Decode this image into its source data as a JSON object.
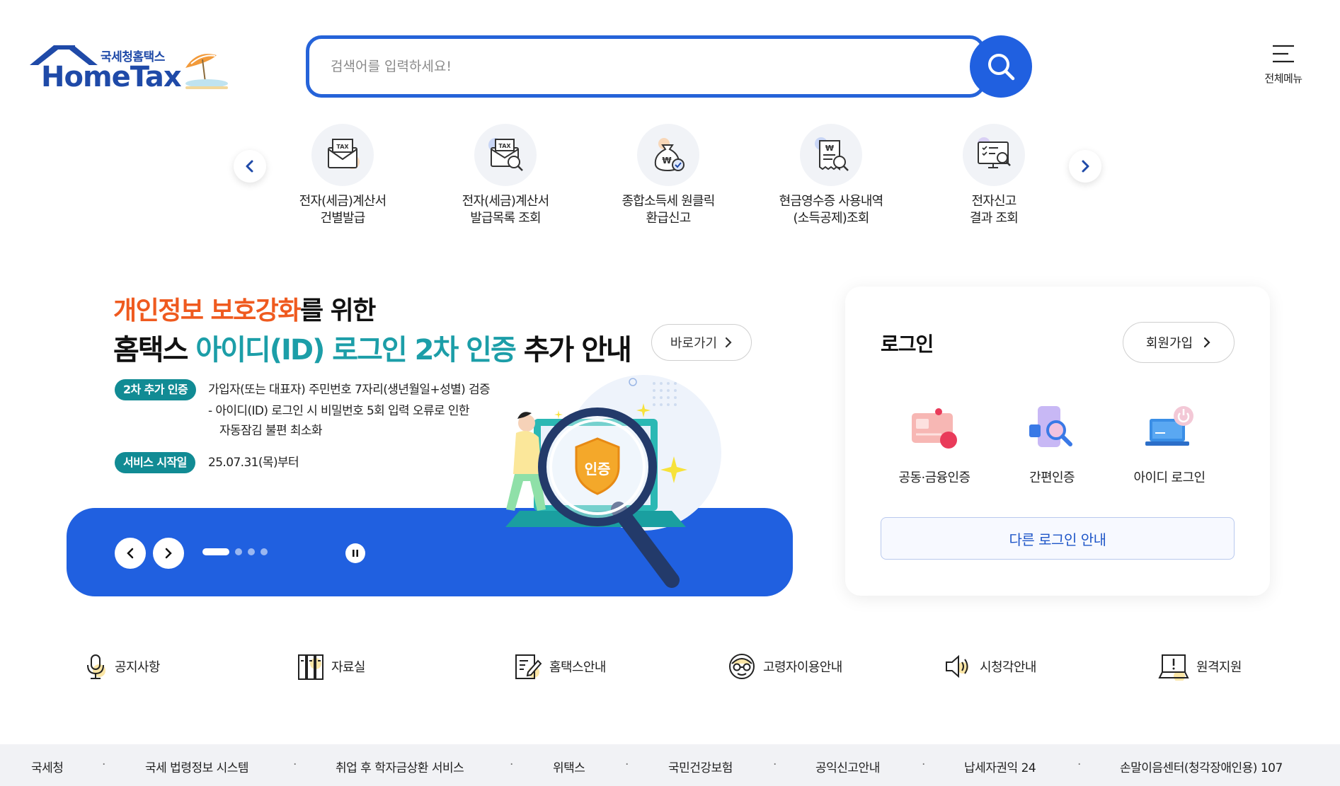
{
  "header": {
    "logo_sub": "국세청홈택스",
    "logo_main": "HomeTax",
    "search_placeholder": "검색어를 입력하세요!",
    "all_menu_label": "전체메뉴"
  },
  "quick_menu": [
    {
      "line1": "전자(세금)계산서",
      "line2": "건별발급",
      "icon": "tax-envelope-icon"
    },
    {
      "line1": "전자(세금)계산서",
      "line2": "발급목록 조회",
      "icon": "tax-search-icon"
    },
    {
      "line1": "종합소득세 원클릭",
      "line2": "환급신고",
      "icon": "money-bag-icon"
    },
    {
      "line1": "현금영수증 사용내역",
      "line2": "(소득공제)조회",
      "icon": "receipt-search-icon"
    },
    {
      "line1": "전자신고",
      "line2": "결과 조회",
      "icon": "monitor-check-icon"
    }
  ],
  "banner": {
    "line1_highlight": "개인정보 보호강화",
    "line1_rest": "를 위한",
    "line2_a": "홈택스 ",
    "line2_highlight": "아이디(ID) 로그인 2차 인증",
    "line2_b": " 추가 안내",
    "go_label": "바로가기",
    "tag1": "2차 추가 인증",
    "text1": "가입자(또는 대표자) 주민번호 7자리(생년월일+성별) 검증",
    "text2": "- 아이디(ID) 로그인 시 비밀번호 5회 입력 오류로 인한",
    "text3": "자동잠김 불편 최소화",
    "tag2": "서비스 시작일",
    "text4": "25.07.31(목)부터",
    "badge": "인증",
    "slide_count": 4,
    "active_slide": 1
  },
  "login": {
    "title": "로그인",
    "signup_label": "회원가입",
    "methods": [
      "공동·금융인증",
      "간편인증",
      "아이디 로그인"
    ],
    "other_label": "다른 로그인 안내"
  },
  "links": [
    "공지사항",
    "자료실",
    "홈택스안내",
    "고령자이용안내",
    "시청각안내",
    "원격지원"
  ],
  "footer": [
    "국세청",
    "국세 법령정보 시스템",
    "취업 후 학자금상환 서비스",
    "위택스",
    "국민건강보험",
    "공익신고안내",
    "납세자권익 24",
    "손말이음센터(청각장애인용) 107"
  ],
  "colors": {
    "primary": "#2060e0",
    "accent_orange": "#ef5a1f",
    "accent_teal": "#1c9ea8",
    "tag_teal": "#118b94"
  }
}
